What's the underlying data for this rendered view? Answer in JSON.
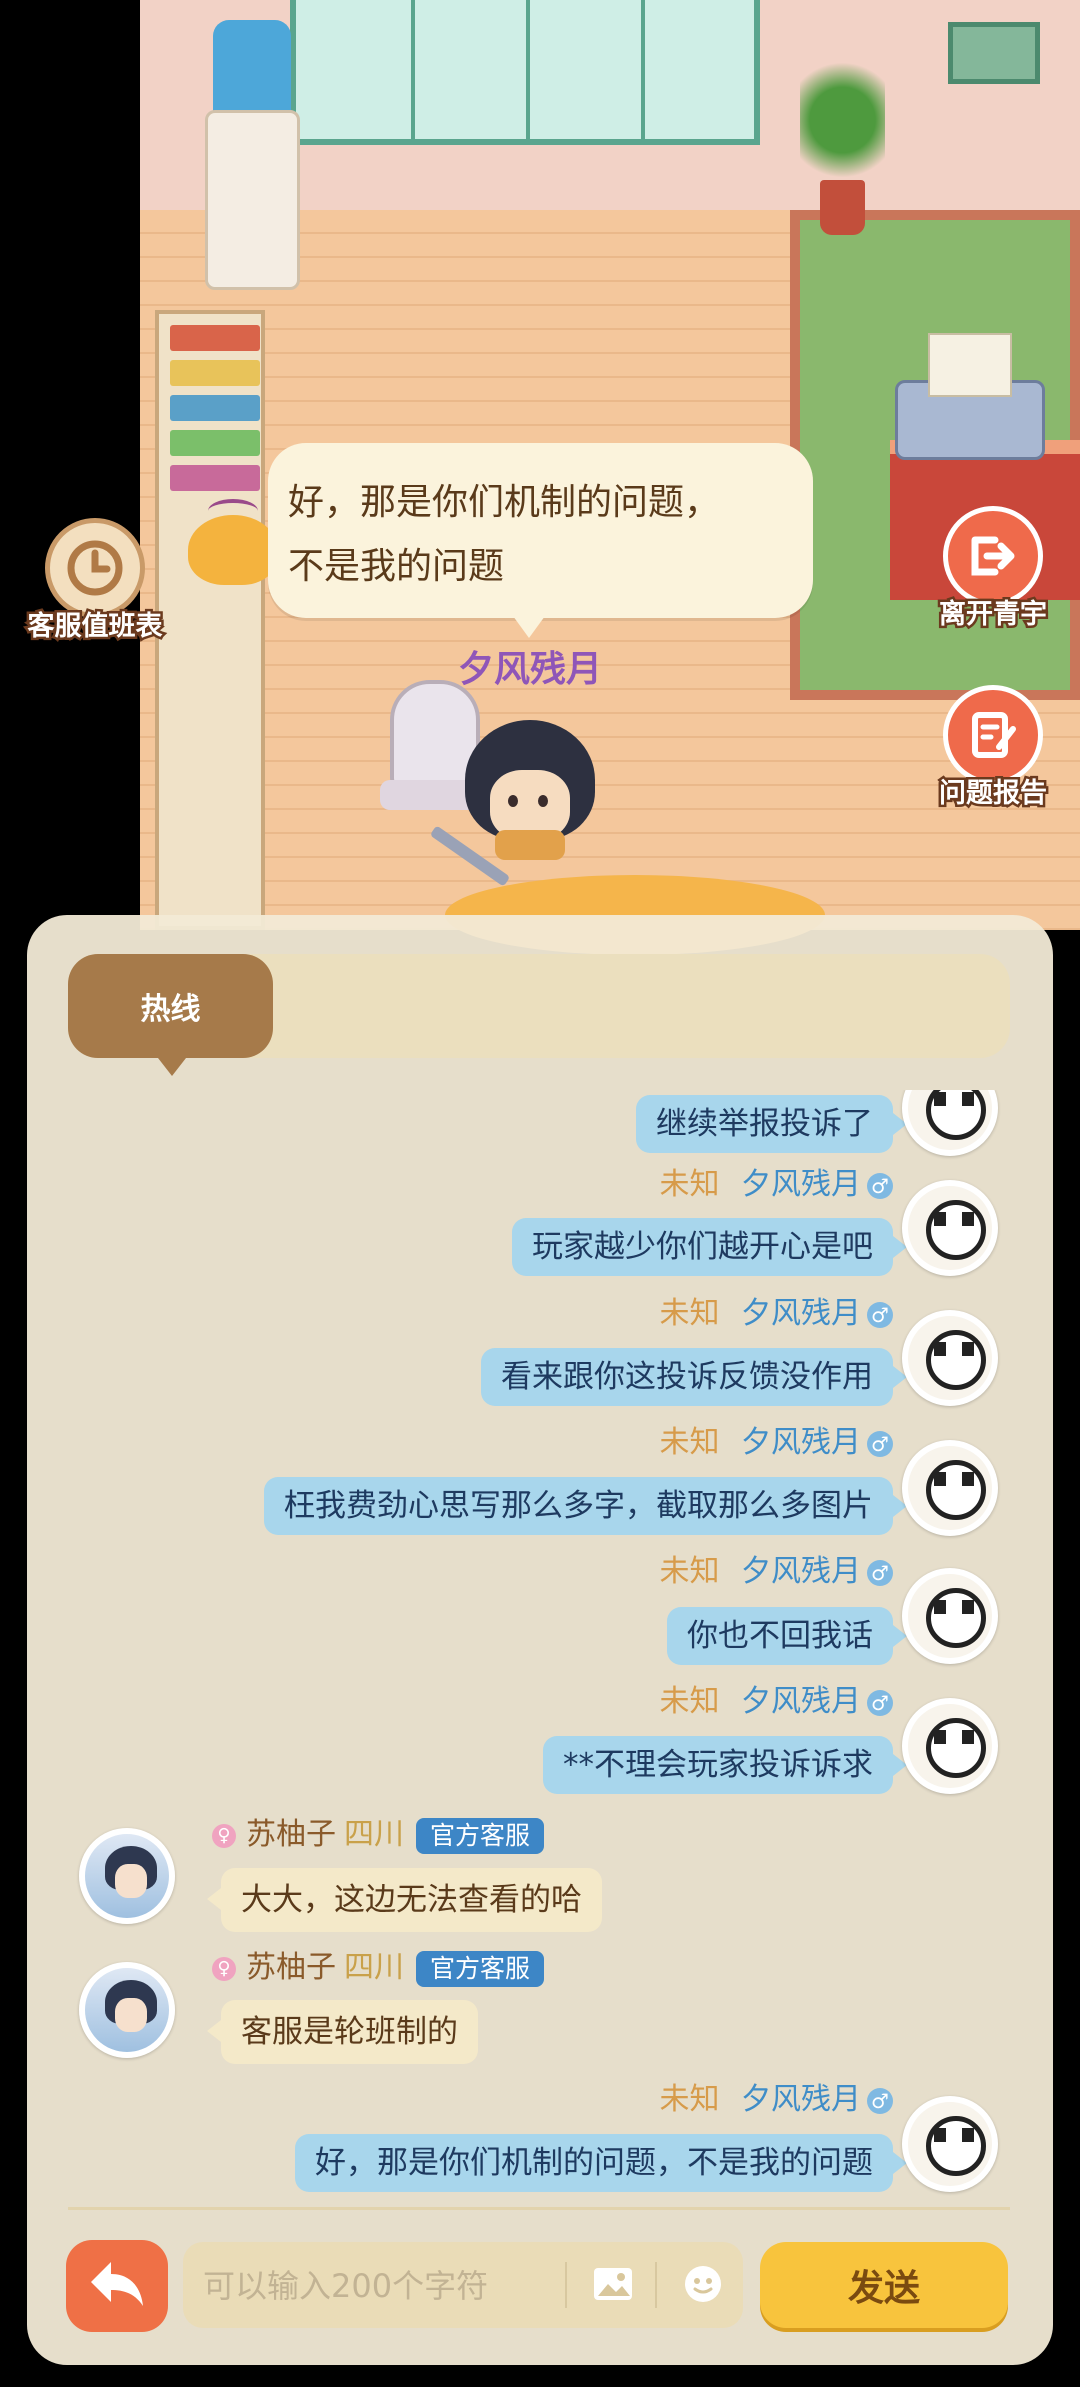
{
  "scene": {
    "speech_line1": "好，那是你们机制的问题，",
    "speech_line2": "不是我的问题",
    "player_name": "夕风残月"
  },
  "side_buttons": {
    "schedule": "客服值班表",
    "leave": "离开青宇",
    "report": "问题报告"
  },
  "channel": {
    "active_tab": "热线"
  },
  "messages": [
    {
      "side": "right",
      "location": "",
      "nick": "",
      "text": "继续举报投诉了"
    },
    {
      "side": "right",
      "location": "未知",
      "nick": "夕风残月",
      "text": "玩家越少你们越开心是吧"
    },
    {
      "side": "right",
      "location": "未知",
      "nick": "夕风残月",
      "text": "看来跟你这投诉反馈没作用"
    },
    {
      "side": "right",
      "location": "未知",
      "nick": "夕风残月",
      "text": "枉我费劲心思写那么多字，截取那么多图片"
    },
    {
      "side": "right",
      "location": "未知",
      "nick": "夕风残月",
      "text": "你也不回我话"
    },
    {
      "side": "right",
      "location": "未知",
      "nick": "夕风残月",
      "text": "**不理会玩家投诉诉求"
    },
    {
      "side": "left",
      "location": "四川",
      "nick": "苏柚子",
      "badge": "官方客服",
      "text": "大大，这边无法查看的哈"
    },
    {
      "side": "left",
      "location": "四川",
      "nick": "苏柚子",
      "badge": "官方客服",
      "text": "客服是轮班制的"
    },
    {
      "side": "right",
      "location": "未知",
      "nick": "夕风残月",
      "text": "好，那是你们机制的问题，不是我的问题"
    }
  ],
  "gender_male": "♂",
  "input": {
    "placeholder": "可以输入200个字符"
  },
  "send_label": "发送",
  "icons": {
    "back": "back-arrow-icon",
    "image": "image-icon",
    "emoji": "emoji-icon",
    "clock": "clock-icon",
    "exit": "exit-icon",
    "report": "edit-note-icon"
  },
  "colors": {
    "accent_orange": "#ef6a4b",
    "send_yellow": "#f8c43d",
    "bubble_blue": "#a8d6ec",
    "nick_blue": "#3f8dc8",
    "badge_blue": "#3d86c6",
    "player_name_purple": "#8f56b8"
  }
}
